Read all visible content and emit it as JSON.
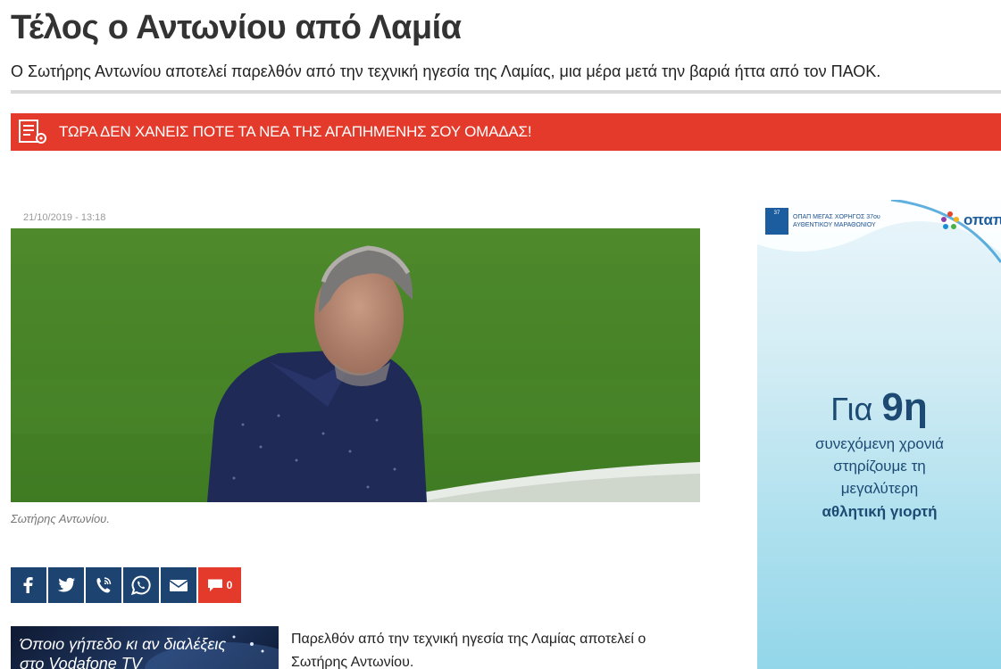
{
  "article": {
    "title": "Τέλος ο Αντωνίου από Λαμία",
    "subtitle": "Ο Σωτήρης Αντωνίου αποτελεί παρελθόν από την τεχνική ηγεσία της Λαμίας, μια μέρα μετά την βαριά ήττα από τον ΠΑΟΚ.",
    "date": "21/10/2019 - 13:18",
    "caption": "Σωτήρης Αντωνίου.",
    "body": "Παρελθόν από την τεχνική ηγεσία της Λαμίας αποτελεί ο Σωτήρης Αντωνίου."
  },
  "banner": {
    "text": "ΤΩΡΑ ΔΕΝ ΧΑΝΕΙΣ ΠΟΤΕ ΤΑ ΝΕΑ ΤΗΣ ΑΓΑΠΗΜΕΝΗΣ ΣΟΥ ΟΜΑΔΑΣ!",
    "icon": "news-settings-icon"
  },
  "share": {
    "buttons": [
      {
        "icon": "facebook-icon"
      },
      {
        "icon": "twitter-icon"
      },
      {
        "icon": "viber-icon"
      },
      {
        "icon": "whatsapp-icon"
      },
      {
        "icon": "email-icon"
      }
    ],
    "comment_count": "0"
  },
  "promo": {
    "line1": "Όποιο γήπεδο κι αν διαλέξεις",
    "line2": "στο Vodafone TV"
  },
  "ad": {
    "sponsor": "ΟΠΑΠ ΜΕΓΑΣ ΧΟΡΗΓΟΣ 37ου ΑΥΘΕΝΤΙΚΟΥ ΜΑΡΑΘΩΝΙΟΥ",
    "brand": "οπαπ",
    "headline_prefix": "Για ",
    "headline_number": "9η",
    "line1": "συνεχόμενη χρονιά",
    "line2": "στηρίζουμε τη",
    "line3": "μεγαλύτερη",
    "line4": "αθλητική γιορτή"
  },
  "colors": {
    "banner_red": "#e43a2b",
    "share_navy": "#1d4370",
    "ad_text": "#1c4a73"
  }
}
